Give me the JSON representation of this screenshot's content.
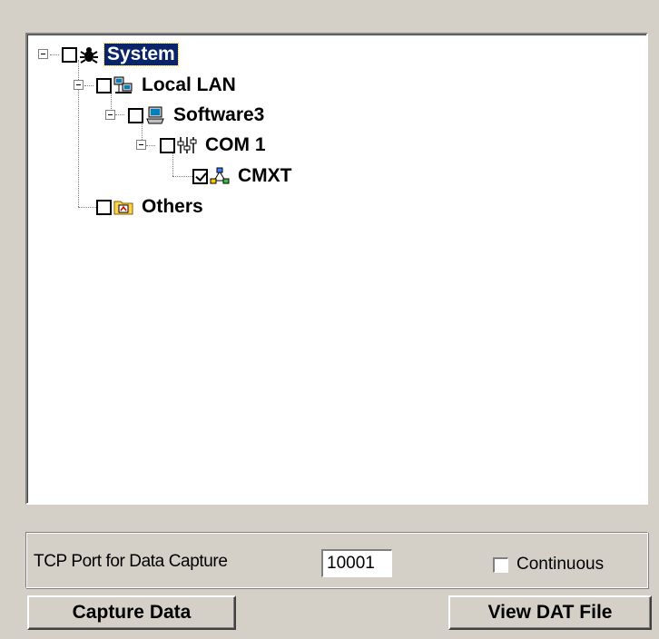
{
  "tree": {
    "nodes": [
      {
        "label": "System",
        "icon": "bug-icon",
        "checked": false,
        "selected": true
      },
      {
        "label": "Local LAN",
        "icon": "network-computers-icon",
        "checked": false
      },
      {
        "label": "Software3",
        "icon": "computer-icon",
        "checked": false
      },
      {
        "label": "COM 1",
        "icon": "serial-port-icon",
        "checked": false
      },
      {
        "label": "CMXT",
        "icon": "network-topology-icon",
        "checked": true
      },
      {
        "label": "Others",
        "icon": "folder-icon",
        "checked": false
      }
    ]
  },
  "capture": {
    "port_label": "TCP Port for Data Capture",
    "port_value": "10001",
    "continuous_label": "Continuous",
    "continuous_checked": false
  },
  "buttons": {
    "capture": "Capture Data",
    "view": "View DAT File"
  },
  "colors": {
    "window_bg": "#d4d0c8",
    "selection_bg": "#0a246a"
  }
}
